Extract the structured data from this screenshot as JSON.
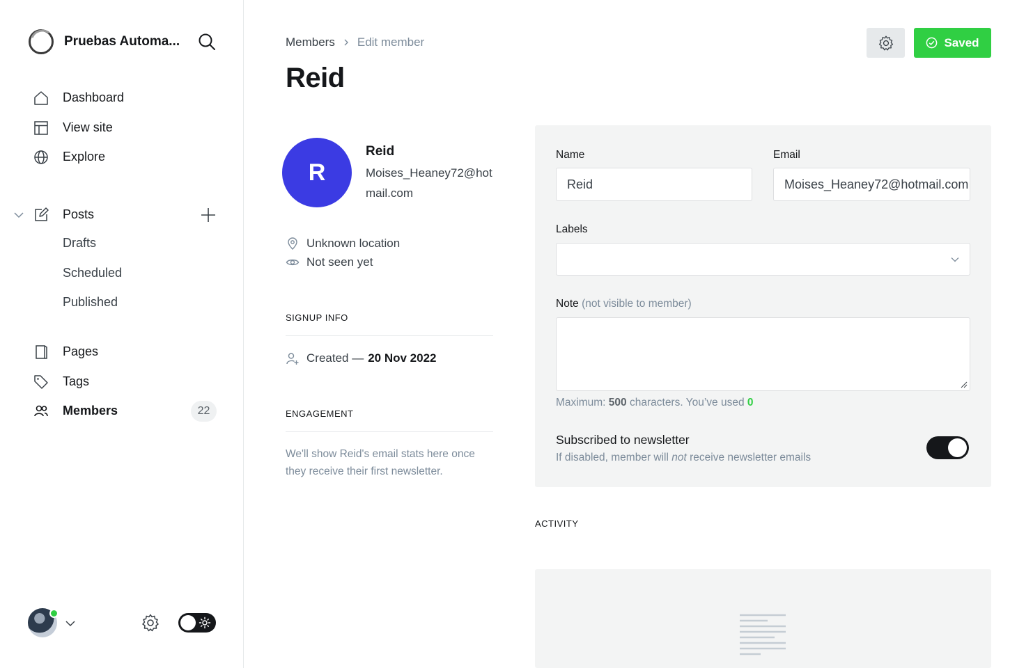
{
  "sidebar": {
    "brand_name": "Pruebas Automa...",
    "nav": {
      "dashboard": "Dashboard",
      "view_site": "View site",
      "explore": "Explore",
      "posts": "Posts",
      "drafts": "Drafts",
      "scheduled": "Scheduled",
      "published": "Published",
      "pages": "Pages",
      "tags": "Tags",
      "members": "Members",
      "members_count": "22"
    }
  },
  "header": {
    "breadcrumb_parent": "Members",
    "breadcrumb_current": "Edit member",
    "title": "Reid",
    "saved_label": "Saved"
  },
  "member": {
    "initial": "R",
    "name": "Reid",
    "email": "Moises_Heaney72@hotmail.com",
    "location": "Unknown location",
    "last_seen": "Not seen yet"
  },
  "signup": {
    "heading": "SIGNUP INFO",
    "created_prefix": "Created —",
    "created_date": "20 Nov 2022"
  },
  "engagement": {
    "heading": "ENGAGEMENT",
    "text": "We'll show Reid's email stats here once they receive their first newsletter."
  },
  "form": {
    "name_label": "Name",
    "name_value": "Reid",
    "email_label": "Email",
    "email_value": "Moises_Heaney72@hotmail.com",
    "labels_label": "Labels",
    "labels_value": "",
    "note_label": "Note",
    "note_hint": "(not visible to member)",
    "note_value": "",
    "max_prefix": "Maximum:",
    "max_chars": "500",
    "max_mid": "characters. You’ve used",
    "used_chars": "0",
    "newsletter_title": "Subscribed to newsletter",
    "newsletter_sub_a": "If disabled, member will",
    "newsletter_sub_em": "not",
    "newsletter_sub_b": "receive newsletter emails",
    "newsletter_enabled": true
  },
  "activity": {
    "heading": "ACTIVITY"
  },
  "colors": {
    "accent_green": "#30cf43",
    "avatar_blue": "#3b3be3",
    "panel_bg": "#f3f4f4"
  }
}
